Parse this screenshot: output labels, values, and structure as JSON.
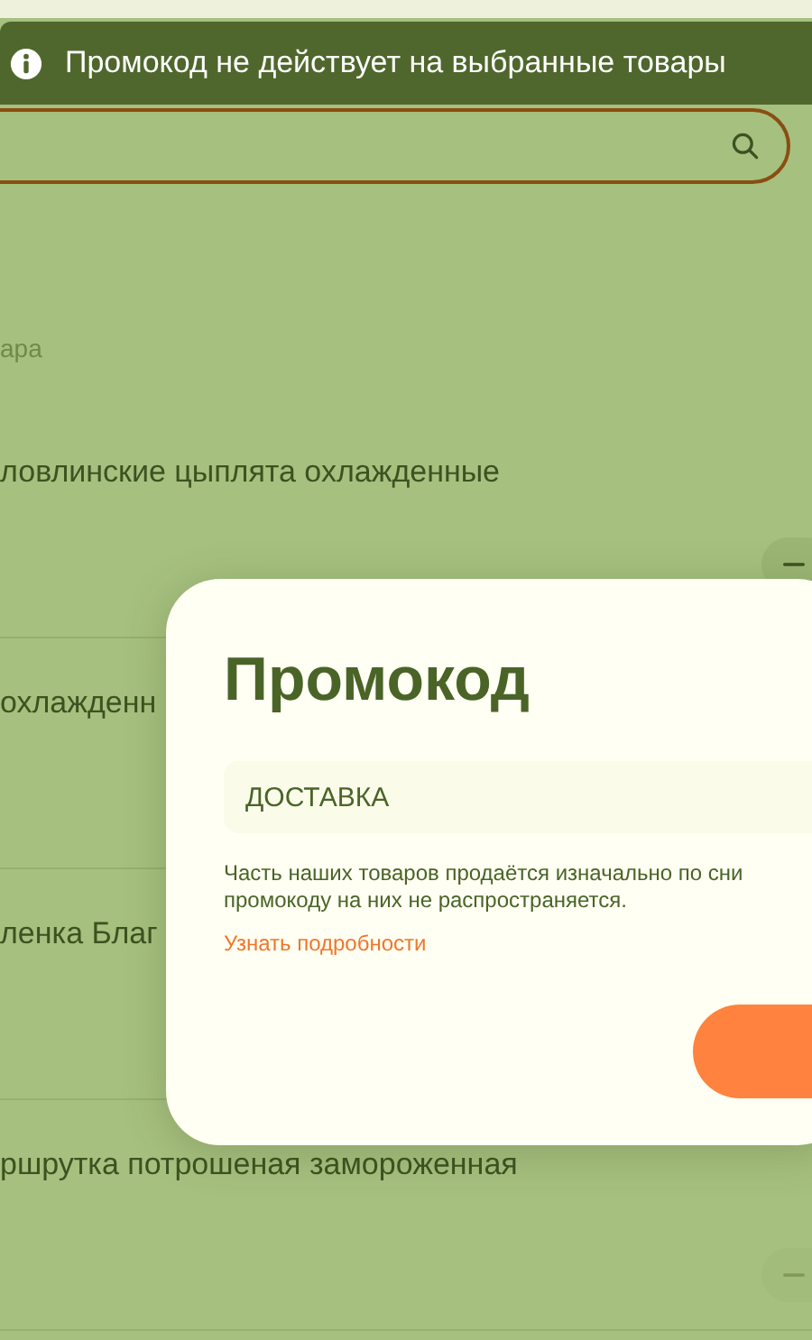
{
  "notification": {
    "text": "Промокод не действует на выбранные товары"
  },
  "section_label": "ара",
  "products": [
    {
      "name": "ловлинские цыплята охлажденные",
      "quantity_control": {
        "disabled": false
      }
    },
    {
      "name": "охлажденн"
    },
    {
      "name": "ленка Благ"
    },
    {
      "name": "ршрутка потрошеная замороженная",
      "quantity_control": {
        "disabled": true
      }
    }
  ],
  "promo_dialog": {
    "title": "Промокод",
    "code_value": "ДОСТАВКА",
    "note_lines": [
      "Часть наших товаров продаётся изначально по сни",
      "промокоду на них не распространяется."
    ],
    "link": "Узнать подробности"
  }
}
